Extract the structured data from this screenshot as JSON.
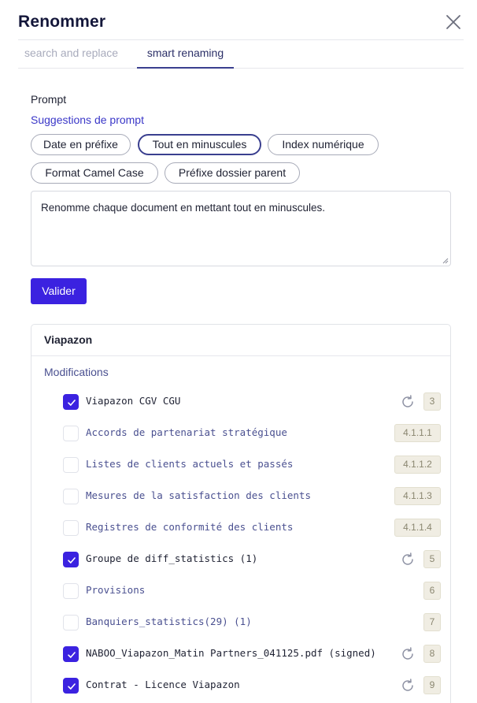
{
  "dialog": {
    "title": "Renommer",
    "close_icon": "close-icon"
  },
  "tabs": [
    {
      "label": "search and replace",
      "active": false
    },
    {
      "label": "smart renaming",
      "active": true
    }
  ],
  "prompt": {
    "label": "Prompt",
    "suggestions_title": "Suggestions de prompt",
    "suggestions": [
      {
        "label": "Date en préfixe",
        "selected": false
      },
      {
        "label": "Tout en minuscules",
        "selected": true
      },
      {
        "label": "Index numérique",
        "selected": false
      },
      {
        "label": "Format Camel Case",
        "selected": false
      },
      {
        "label": "Préfixe dossier parent",
        "selected": false
      }
    ],
    "value": "Renomme chaque document en mettant tout en minuscules.",
    "submit_label": "Valider"
  },
  "results": {
    "group_title": "Viapazon",
    "section_label": "Modifications",
    "items": [
      {
        "name": "Viapazon CGV CGU",
        "checked": true,
        "refresh": true,
        "index": "3"
      },
      {
        "name": "Accords de partenariat stratégique",
        "checked": false,
        "refresh": false,
        "index": "4.1.1.1"
      },
      {
        "name": "Listes de clients actuels et passés",
        "checked": false,
        "refresh": false,
        "index": "4.1.1.2"
      },
      {
        "name": "Mesures de la satisfaction des clients",
        "checked": false,
        "refresh": false,
        "index": "4.1.1.3"
      },
      {
        "name": "Registres de conformité des clients",
        "checked": false,
        "refresh": false,
        "index": "4.1.1.4"
      },
      {
        "name": "Groupe de diff_statistics (1)",
        "checked": true,
        "refresh": true,
        "index": "5"
      },
      {
        "name": "Provisions",
        "checked": false,
        "refresh": false,
        "index": "6"
      },
      {
        "name": "Banquiers_statistics(29) (1)",
        "checked": false,
        "refresh": false,
        "index": "7"
      },
      {
        "name": "NABOO_Viapazon_Matin Partners_041125.pdf (signed)",
        "checked": true,
        "refresh": true,
        "index": "8"
      },
      {
        "name": "Contrat - Licence Viapazon",
        "checked": true,
        "refresh": true,
        "index": "9"
      }
    ]
  },
  "colors": {
    "accent": "#3b22e0",
    "active_tab": "#3a3f8f",
    "badge_bg": "#f0ede3"
  }
}
